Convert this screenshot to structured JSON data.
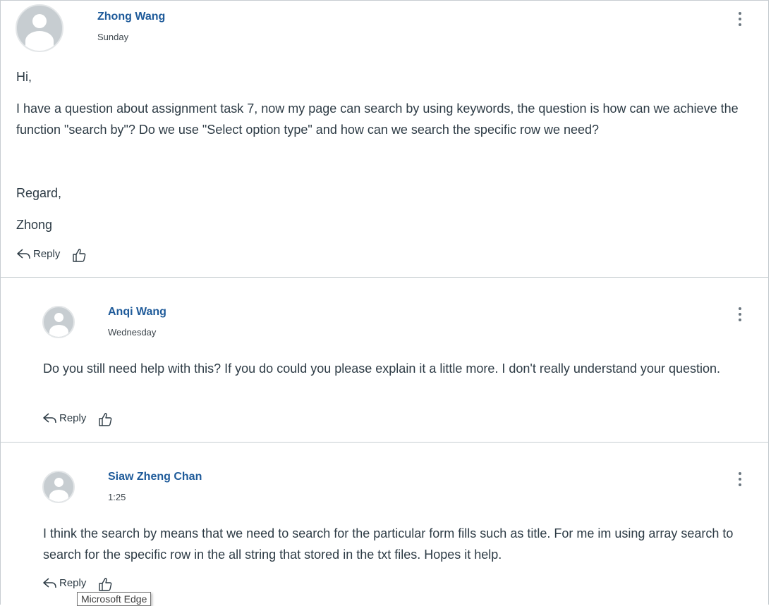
{
  "entries": [
    {
      "author": "Zhong Wang",
      "date": "Sunday",
      "paragraphs": [
        "Hi,",
        "I have a question about assignment task 7, now my page can search by using keywords, the question is how can we achieve the function \"search by\"? Do we use \"Select option type\" and how can we search the specific row we need?",
        "Regard,",
        "Zhong"
      ],
      "reply_label": "Reply"
    },
    {
      "author": "Anqi Wang",
      "date": "Wednesday",
      "paragraphs": [
        "Do you still need help with this? If you do could you please explain it a little more. I don't really understand your question."
      ],
      "reply_label": "Reply"
    },
    {
      "author": "Siaw Zheng Chan",
      "date": "1:25",
      "paragraphs": [
        "I think the search by means that we need to search for the particular form fills such as title. For me im using array search to search for the specific row in the all string that stored in the txt files. Hopes it help."
      ],
      "reply_label": "Reply"
    }
  ],
  "tooltip": {
    "text": "Microsoft Edge"
  },
  "colors": {
    "author_link": "#1f5b9a",
    "text": "#2d3b45",
    "divider": "#c7cdd1"
  }
}
